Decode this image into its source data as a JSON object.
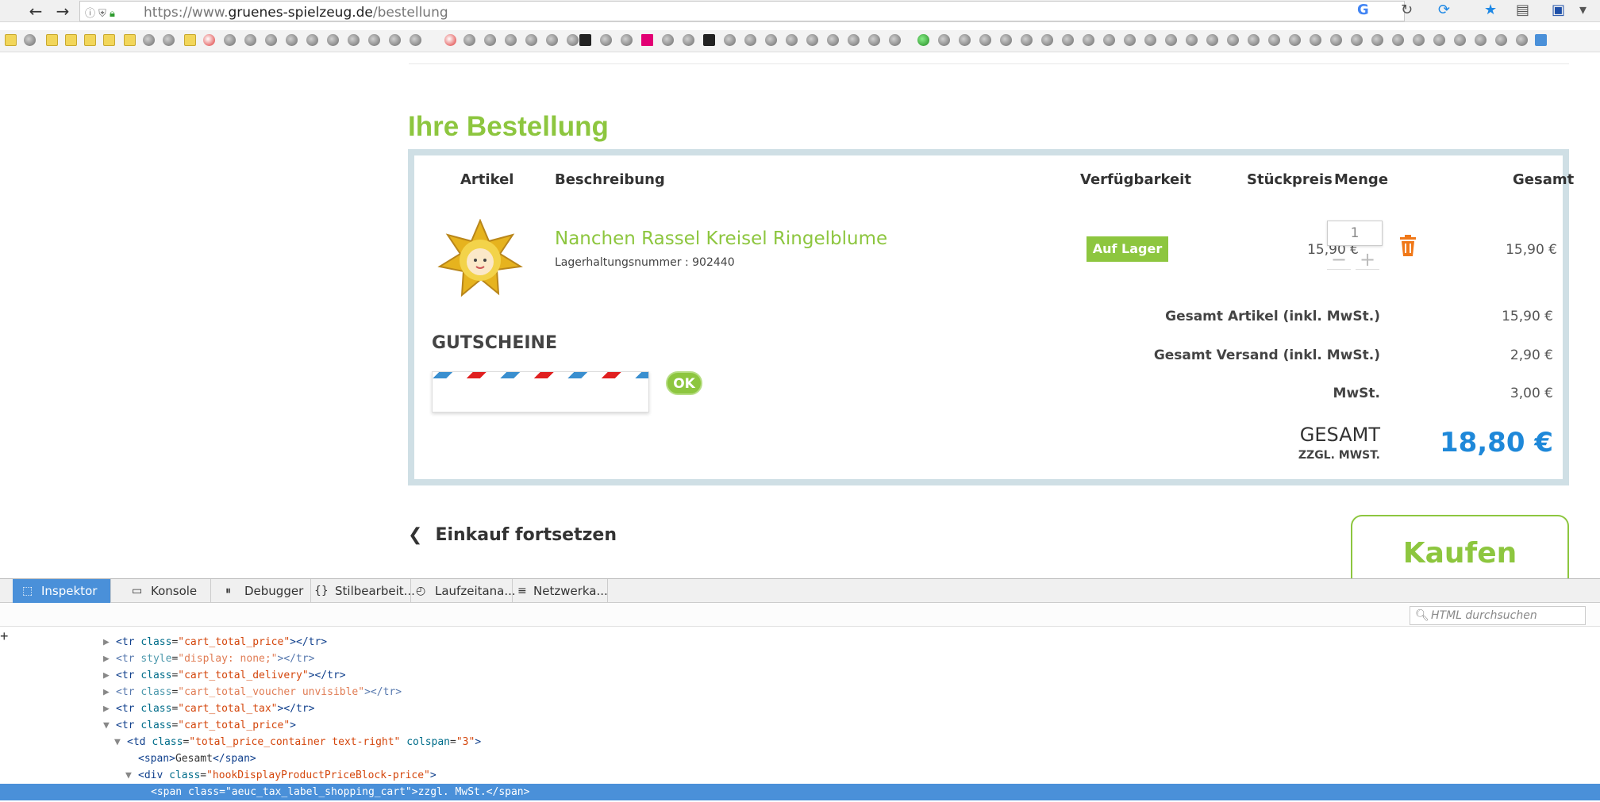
{
  "browser": {
    "url_prefix": "https://www.",
    "url_domain": "gruenes-spielzeug.de",
    "url_path": "/bestellung"
  },
  "order": {
    "title": "Ihre Bestellung",
    "headers": {
      "article": "Artikel",
      "description": "Beschreibung",
      "availability": "Verfügbarkeit",
      "unit_price": "Stückpreis",
      "quantity": "Menge",
      "total": "Gesamt"
    },
    "item": {
      "name": "Nanchen Rassel Kreisel Ringelblume",
      "sku": "Lagerhaltungsnummer : 902440",
      "stock": "Auf Lager",
      "unit_price": "15,90 €",
      "quantity": "1",
      "line_total": "15,90 €"
    },
    "voucher": {
      "title": "GUTSCHEINE",
      "button": "OK"
    },
    "summary": [
      {
        "label": "Gesamt Artikel (inkl. MwSt.)",
        "value": "15,90 €"
      },
      {
        "label": "Gesamt Versand (inkl. MwSt.)",
        "value": "2,90 €"
      },
      {
        "label": "MwSt.",
        "value": "3,00 €"
      }
    ],
    "grand_total": {
      "label": "GESAMT",
      "sub": "ZZGL. MWST.",
      "value": "18,80 €"
    },
    "continue": "Einkauf fortsetzen",
    "buy": "Kaufen"
  },
  "devtools": {
    "tabs": [
      "Inspektor",
      "Konsole",
      "Debugger",
      "Stilbearbeit...",
      "Laufzeitana...",
      "Netzwerka..."
    ],
    "search_placeholder": "HTML durchsuchen"
  },
  "colors": {
    "brand_green": "#8dc63f",
    "price_blue": "#1e88d9",
    "selection_blue": "#4a90d9"
  }
}
